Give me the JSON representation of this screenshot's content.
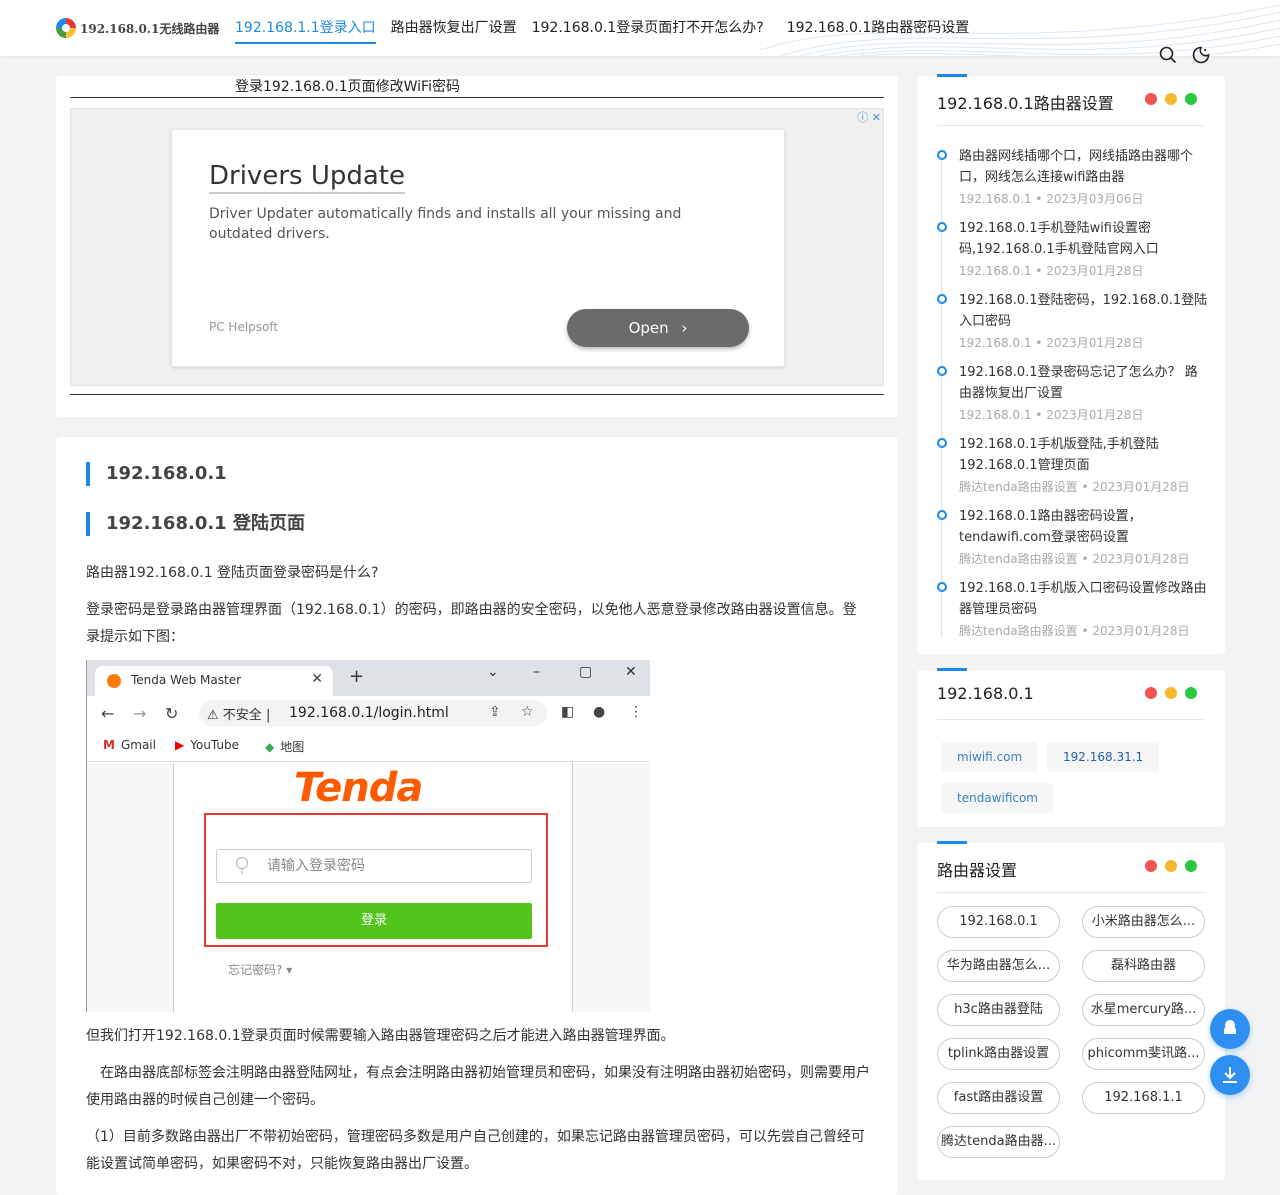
{
  "header": {
    "logo_text": "192.168.0.1无线路由器",
    "nav": [
      {
        "label": "192.168.1.1登录入口",
        "active": true
      },
      {
        "label": "路由器恢复出厂设置"
      },
      {
        "label": "192.168.0.1登录页面打不开怎么办?"
      },
      {
        "label": "192.168.0.1路由器密码设置"
      }
    ],
    "icons": [
      "search-icon",
      "dark-mode-icon"
    ]
  },
  "top_card": {
    "title": "登录192.168.0.1页面修改WiFi密码",
    "ad": {
      "title": "Drivers Update",
      "description": "Driver Updater automatically finds and installs all your missing and outdated drivers.",
      "brand": "PC Helpsoft",
      "button": "Open"
    }
  },
  "article": {
    "h2_1": "192.168.0.1",
    "h2_2": "192.168.0.1 登陆页面",
    "p1": "路由器192.168.0.1 登陆页面登录密码是什么?",
    "p2": " 登录密码是登录路由器管理界面（192.168.0.1）的密码，即路由器的安全密码，以免他人恶意登录修改路由器设置信息。登录提示如下图：",
    "p3": "但我们打开192.168.0.1登录页面时候需要输入路由器管理密码之后才能进入路由器管理界面。",
    "p4": "　在路由器底部标签会注明路由器登陆网址，有点会注明路由器初始管理员和密码，如果没有注明路由器初始密码，则需要用户使用路由器的时候自己创建一个密码。",
    "p5": "（1）目前多数路由器出厂不带初始密码，管理密码多数是用户自己创建的，如果忘记路由器管理员密码，可以先尝自己曾经可能设置试简单密码，如果密码不对，只能恢复路由器出厂设置。",
    "screenshot": {
      "tab_title": "Tenda Web Master",
      "insecure": "不安全",
      "url": "192.168.0.1/login.html",
      "bookmarks": [
        "Gmail",
        "YouTube",
        "地图"
      ],
      "logo": "Tenda",
      "password_placeholder": "请输入登录密码",
      "login_button": "登录",
      "forgot": "忘记密码?"
    }
  },
  "sidebar": {
    "dot_colors": [
      "#f5534f",
      "#f6b829",
      "#28c840"
    ],
    "router_settings": {
      "title": "192.168.0.1路由器设置",
      "items": [
        {
          "title": "路由器网线插哪个口，网线插路由器哪个口，网线怎么连接wifi路由器",
          "category": "192.168.0.1",
          "date": "2023月03月06日"
        },
        {
          "title": "192.168.0.1手机登陆wifi设置密码,192.168.0.1手机登陆官网入口",
          "category": "192.168.0.1",
          "date": "2023月01月28日"
        },
        {
          "title": "192.168.0.1登陆密码，192.168.0.1登陆入口密码",
          "category": "192.168.0.1",
          "date": "2023月01月28日"
        },
        {
          "title": "192.168.0.1登录密码忘记了怎么办？ 路由器恢复出厂设置",
          "category": "192.168.0.1",
          "date": "2023月01月28日"
        },
        {
          "title": "192.168.0.1手机版登陆,手机登陆192.168.0.1管理页面",
          "category": "腾达tenda路由器设置",
          "date": "2023月01月28日"
        },
        {
          "title": "192.168.0.1路由器密码设置，tendawifi.com登录密码设置",
          "category": "腾达tenda路由器设置",
          "date": "2023月01月28日"
        },
        {
          "title": "192.168.0.1手机版入口密码设置修改路由器管理员密码",
          "category": "腾达tenda路由器设置",
          "date": "2023月01月28日"
        }
      ]
    },
    "tag_card": {
      "title": "192.168.0.1",
      "tags": [
        "miwifi.com",
        "192.168.31.1",
        "tendawificom"
      ]
    },
    "category_card": {
      "title": "路由器设置",
      "pills": [
        "192.168.0.1",
        "小米路由器怎么...",
        "华为路由器怎么...",
        "磊科路由器",
        "h3c路由器登陆",
        "水星mercury路...",
        "tplink路由器设置",
        "phicomm斐讯路...",
        "fast路由器设置",
        "192.168.1.1",
        "腾达tenda路由器..."
      ]
    }
  },
  "float_buttons": [
    "chat-icon",
    "download-icon"
  ]
}
